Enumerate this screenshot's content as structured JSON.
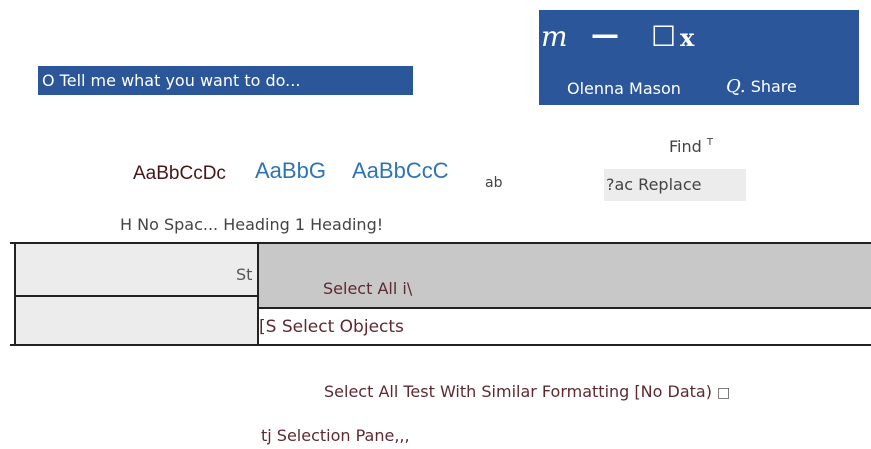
{
  "search": {
    "tell_me": "O Tell me what you want to do..."
  },
  "window_controls": {
    "minimize_glyph_m": "m",
    "minimize_glyph_dash": "—",
    "maximize_glyph": "☐",
    "close_glyph": "x"
  },
  "account": {
    "user_name": "Olenna Mason",
    "share_icon": "Q.",
    "share_label": "Share"
  },
  "editing": {
    "find_label": "Find",
    "find_caret": "T",
    "replace_label": "?ac Replace",
    "select_all_label": "Select All i\\",
    "select_objects_label": "[S Select Objects",
    "select_similar_label": "Select All Test With Similar Formatting [No Data)",
    "select_similar_check": "□",
    "selection_pane_label": "tj Selection Pane,,,"
  },
  "styles": {
    "preview_normal": "AaBbCcDc",
    "preview_heading1": "AaBbG",
    "preview_heading2": "AaBbCcC",
    "preview_ab": "ab",
    "labels": "H No Spac... Heading 1 Heading!",
    "group_label_fragment": "St"
  },
  "colors": {
    "ribbon_blue": "#2b579a",
    "heading_blue": "#2e74b5",
    "menu_text": "#5c2a30",
    "highlight_gray": "#c8c8c8",
    "panel_gray": "#ececec"
  }
}
